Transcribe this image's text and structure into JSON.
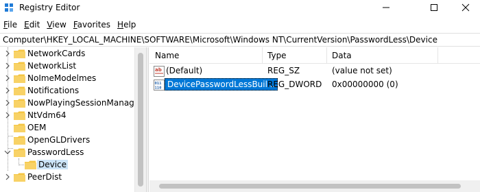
{
  "window": {
    "title": "Registry Editor"
  },
  "menu": {
    "items": [
      {
        "key": "F",
        "rest": "ile"
      },
      {
        "key": "E",
        "rest": "dit"
      },
      {
        "key": "V",
        "rest": "iew"
      },
      {
        "key": "F",
        "rest": "avorites"
      },
      {
        "key": "H",
        "rest": "elp"
      }
    ]
  },
  "address": {
    "path": "Computer\\HKEY_LOCAL_MACHINE\\SOFTWARE\\Microsoft\\Windows NT\\CurrentVersion\\PasswordLess\\Device"
  },
  "tree": {
    "items": [
      {
        "label": "NetworkCards",
        "expanded": false
      },
      {
        "label": "NetworkList",
        "expanded": false
      },
      {
        "label": "NoImeModelmes",
        "expanded": false
      },
      {
        "label": "Notifications",
        "expanded": false
      },
      {
        "label": "NowPlayingSessionManager",
        "expanded": false
      },
      {
        "label": "NtVdm64",
        "expanded": false
      },
      {
        "label": "OEM",
        "expanded": null
      },
      {
        "label": "OpenGLDrivers",
        "expanded": null
      },
      {
        "label": "PasswordLess",
        "expanded": true
      },
      {
        "label": "Device",
        "expanded": null,
        "child": true,
        "selected": true
      },
      {
        "label": "PeerDist",
        "expanded": false
      }
    ]
  },
  "list": {
    "columns": {
      "name": "Name",
      "type": "Type",
      "data": "Data"
    },
    "rows": [
      {
        "icon": "string-value-icon",
        "name": "(Default)",
        "type": "REG_SZ",
        "data": "(value not set)",
        "selected": false
      },
      {
        "icon": "dword-value-icon",
        "name": "DevicePasswordLessBuil...",
        "type": "REG_DWORD",
        "data": "0x00000000 (0)",
        "selected": true
      }
    ]
  },
  "colors": {
    "folder": "#f4c542",
    "selection": "#0078d7",
    "tree_selection": "#cce4f7"
  }
}
